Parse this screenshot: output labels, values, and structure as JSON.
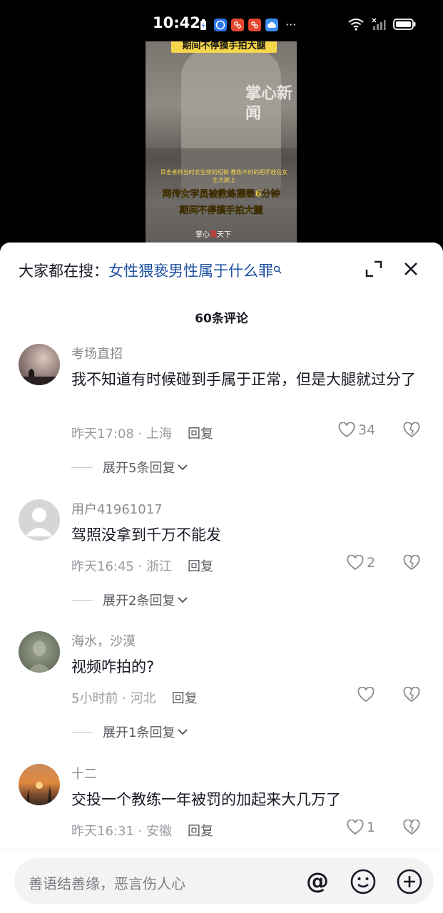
{
  "status_bar": {
    "time": "10:42",
    "more": "···",
    "icons": [
      "battery-saver-icon",
      "browser-app-icon",
      "app-icon-red",
      "app-icon-red",
      "weather-cloud-icon",
      "wifi-icon",
      "no-signal-icon",
      "battery-icon"
    ]
  },
  "video": {
    "top_caption": "期间不停摸手拍大腿",
    "watermark": "掌心新闻",
    "small_caption": "目击者称当时女生穿的短裤 教练不时的把手放在女生大腿上",
    "caption_line1": "网传女学员被教练猥亵6分钟",
    "caption_line2": "期间不停摸手拍大腿",
    "logo_prefix": "掌心",
    "logo_mark": "观",
    "logo_suffix": "天下"
  },
  "search": {
    "prefix": "大家都在搜：",
    "query": "女性猥亵男性属于什么罪",
    "icon": "search-icon"
  },
  "comment_count": "60条评论",
  "comments": [
    {
      "username": "考场直招",
      "text": "我不知道有时候碰到手属于正常，但是大腿就过分了",
      "time_location": "昨天17:08 · 上海",
      "reply": "回复",
      "likes": "34",
      "expand": "展开5条回复"
    },
    {
      "username": "用户41961017",
      "text": "驾照没拿到千万不能发",
      "time_location": "昨天16:45 · 浙江",
      "reply": "回复",
      "likes": "2",
      "expand": "展开2条回复"
    },
    {
      "username": "海水，沙漠",
      "text": "视频咋拍的?",
      "time_location": "5小时前 · 河北",
      "reply": "回复",
      "likes": "",
      "expand": "展开1条回复"
    },
    {
      "username": "十二",
      "text": "交投一个教练一年被罚的加起来大几万了",
      "time_location": "昨天16:31 · 安徽",
      "reply": "回复",
      "likes": "1",
      "expand": ""
    }
  ],
  "input": {
    "placeholder": "善语结善缘，恶言伤人心"
  },
  "colors": {
    "link_blue": "#1c4fa0",
    "caption_yellow": "#f6d64a",
    "muted_text": "#8a8b91"
  }
}
